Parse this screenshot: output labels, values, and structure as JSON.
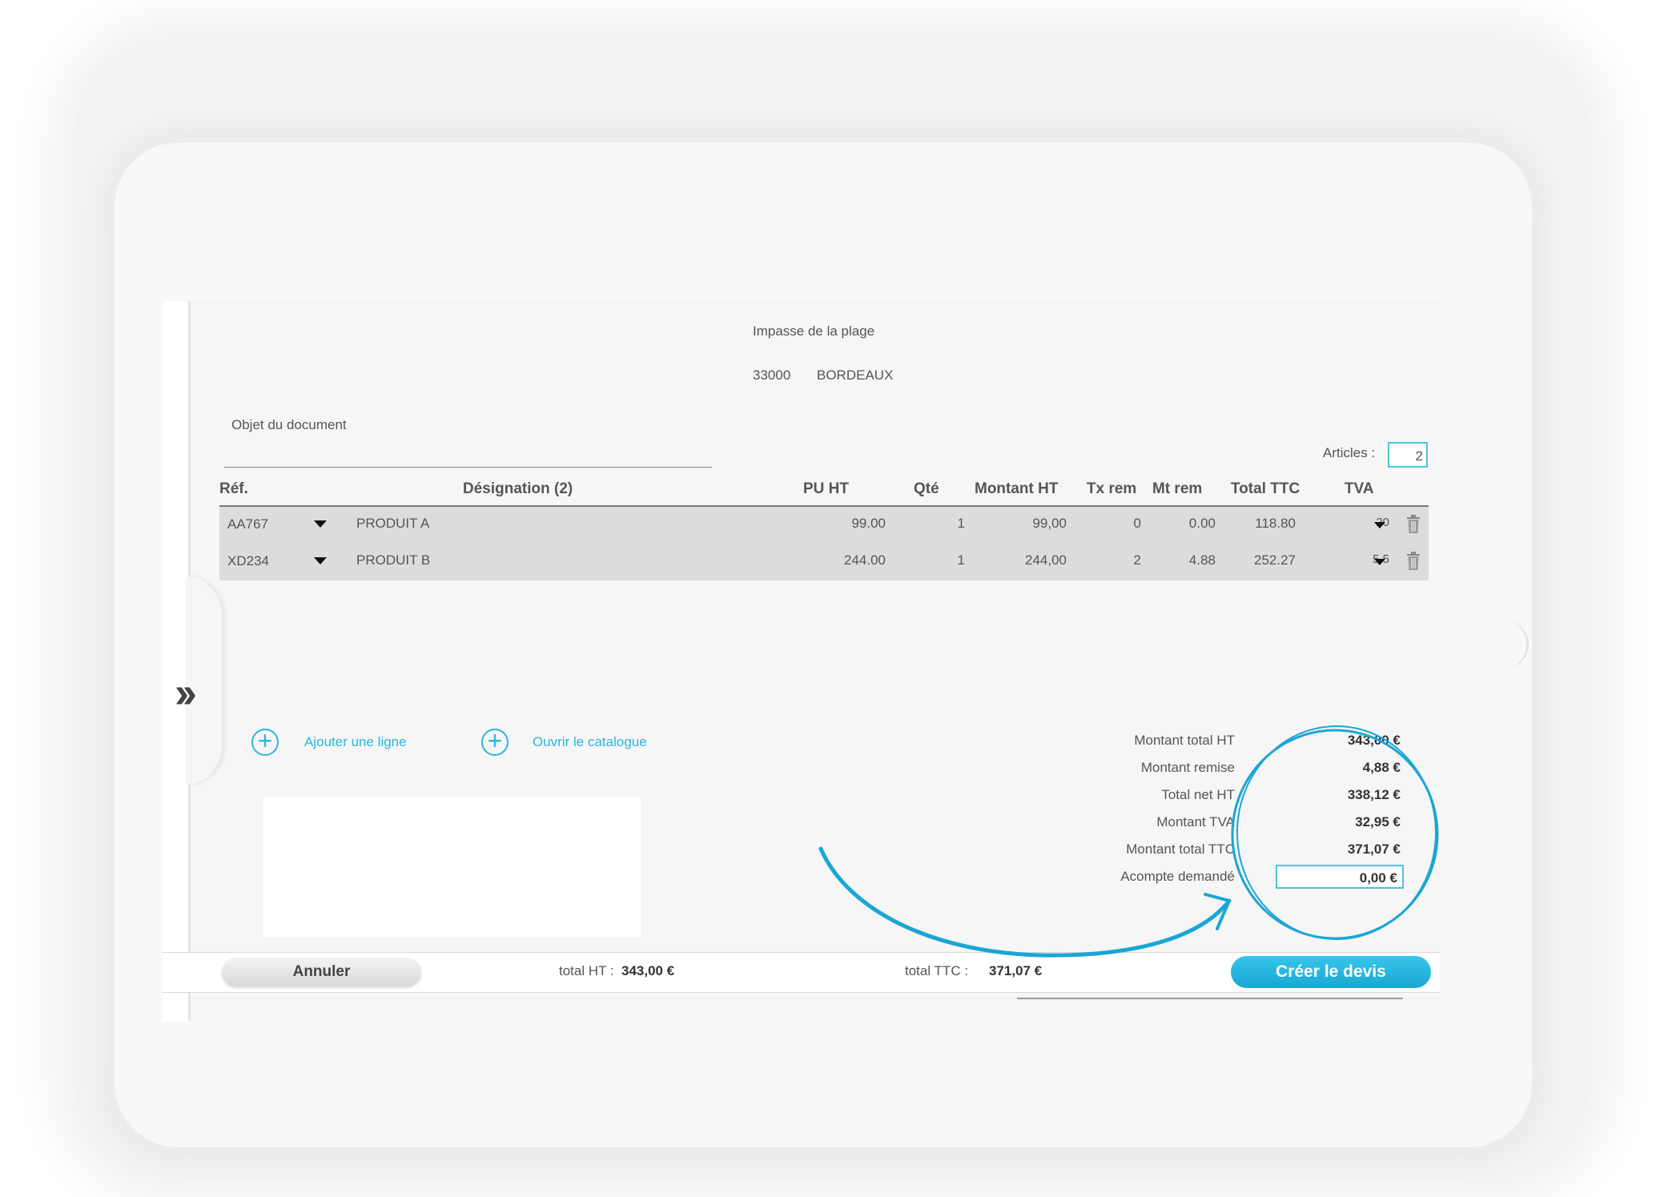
{
  "address": {
    "street": "Impasse de la plage",
    "postcode": "33000",
    "city": "BORDEAUX"
  },
  "document": {
    "object_label": "Objet du document"
  },
  "articles": {
    "label": "Articles :",
    "count": "2"
  },
  "table": {
    "headers": {
      "ref": "Réf.",
      "designation": "Désignation (2)",
      "pu_ht": "PU HT",
      "qte": "Qté",
      "montant_ht": "Montant HT",
      "tx_rem": "Tx rem",
      "mt_rem": "Mt rem",
      "total_ttc": "Total TTC",
      "tva": "TVA"
    },
    "rows": [
      {
        "ref": "AA767",
        "designation": "PRODUIT A",
        "pu_ht": "99.00",
        "qte": "1",
        "montant_ht": "99,00",
        "tx_rem": "0",
        "mt_rem": "0.00",
        "total_ttc": "118.80",
        "tva": "20"
      },
      {
        "ref": "XD234",
        "designation": "PRODUIT B",
        "pu_ht": "244.00",
        "qte": "1",
        "montant_ht": "244,00",
        "tx_rem": "2",
        "mt_rem": "4.88",
        "total_ttc": "252.27",
        "tva": "5.5"
      }
    ]
  },
  "actions": {
    "add_line": "Ajouter une ligne",
    "open_catalog": "Ouvrir le catalogue"
  },
  "summary": {
    "montant_total_ht": {
      "label": "Montant total HT",
      "value": "343,00 €"
    },
    "montant_remise": {
      "label": "Montant remise",
      "value": "4,88 €"
    },
    "total_net_ht": {
      "label": "Total net HT",
      "value": "338,12 €"
    },
    "montant_tva": {
      "label": "Montant TVA",
      "value": "32,95 €"
    },
    "montant_total_ttc": {
      "label": "Montant total TTC",
      "value": "371,07 €"
    },
    "acompte": {
      "label": "Acompte demandé",
      "value": "0,00 €"
    }
  },
  "footer": {
    "cancel_label": "Annuler",
    "total_ht_label": "total HT :",
    "total_ht_value": "343,00 €",
    "total_ttc_label": "total TTC :",
    "total_ttc_value": "371,07 €",
    "create_label": "Créer le devis"
  },
  "colors": {
    "accent": "#29b6e0",
    "row_bg": "#dcdcdc",
    "annotation": "#1aa6d5"
  }
}
